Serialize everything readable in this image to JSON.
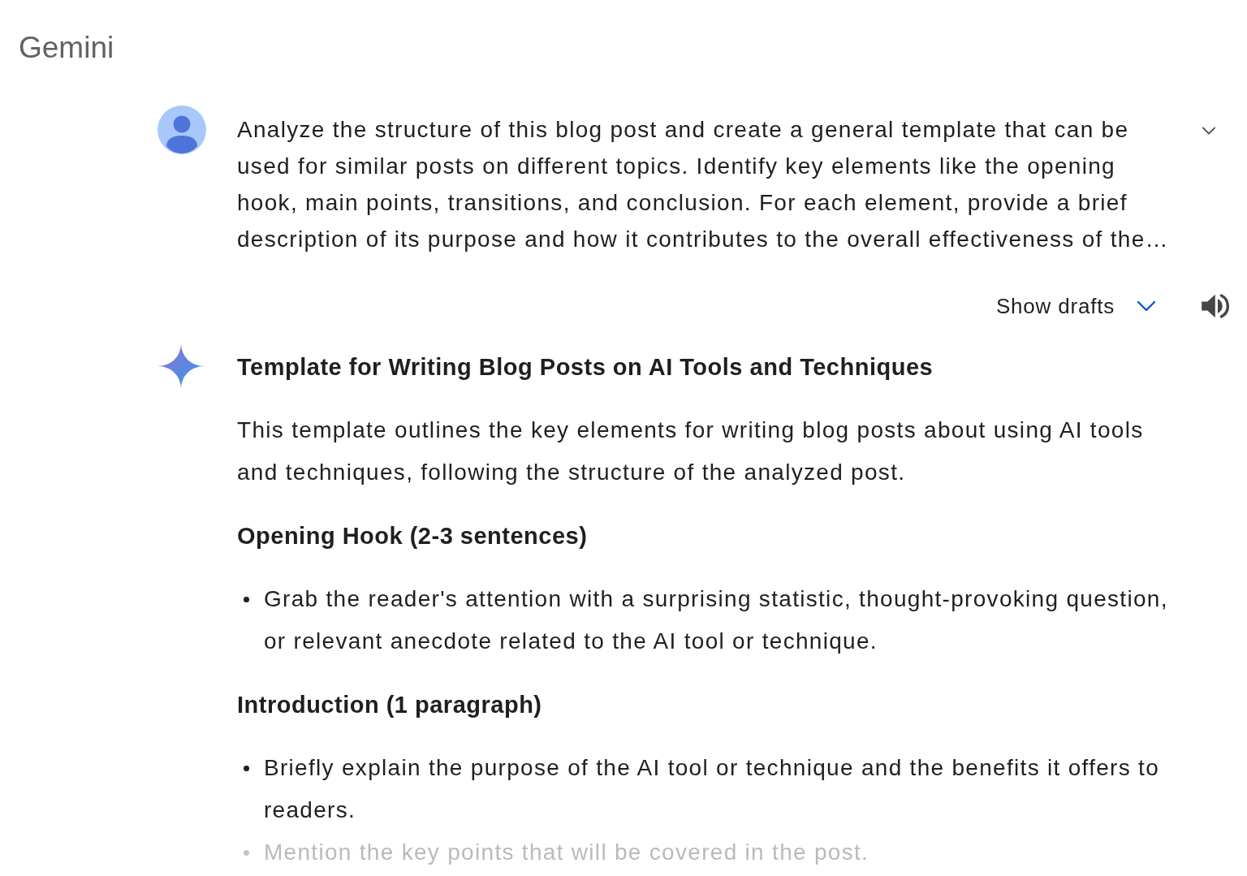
{
  "app_title": "Gemini",
  "prompt": {
    "text": "Analyze the structure of this blog post and create a general template that can be used for similar posts on different topics. Identify key elements like the opening hook, main points, transitions, and conclusion. For each element, provide a brief description of its purpose and how it contributes to the overall effectiveness of the…",
    "expanded": false
  },
  "drafts": {
    "label": "Show drafts",
    "expanded": false
  },
  "response": {
    "title": "Template for Writing Blog Posts on AI Tools and Techniques",
    "blocks": [
      {
        "kind": "paragraph",
        "text": "This template outlines the key elements for writing blog posts about using AI tools and techniques, following the structure of the analyzed post."
      },
      {
        "kind": "heading",
        "text": "Opening Hook (2-3 sentences)"
      },
      {
        "kind": "bullets",
        "items": [
          {
            "text": "Grab the reader's attention with a surprising statistic, thought-provoking question, or relevant anecdote related to the AI tool or technique.",
            "faded": false
          }
        ]
      },
      {
        "kind": "heading",
        "text": "Introduction (1 paragraph)"
      },
      {
        "kind": "bullets",
        "items": [
          {
            "text": "Briefly explain the purpose of the AI tool or technique and the benefits it offers to readers.",
            "faded": false
          },
          {
            "text": "Mention the key points that will be covered in the post.",
            "faded": true
          }
        ]
      }
    ]
  }
}
